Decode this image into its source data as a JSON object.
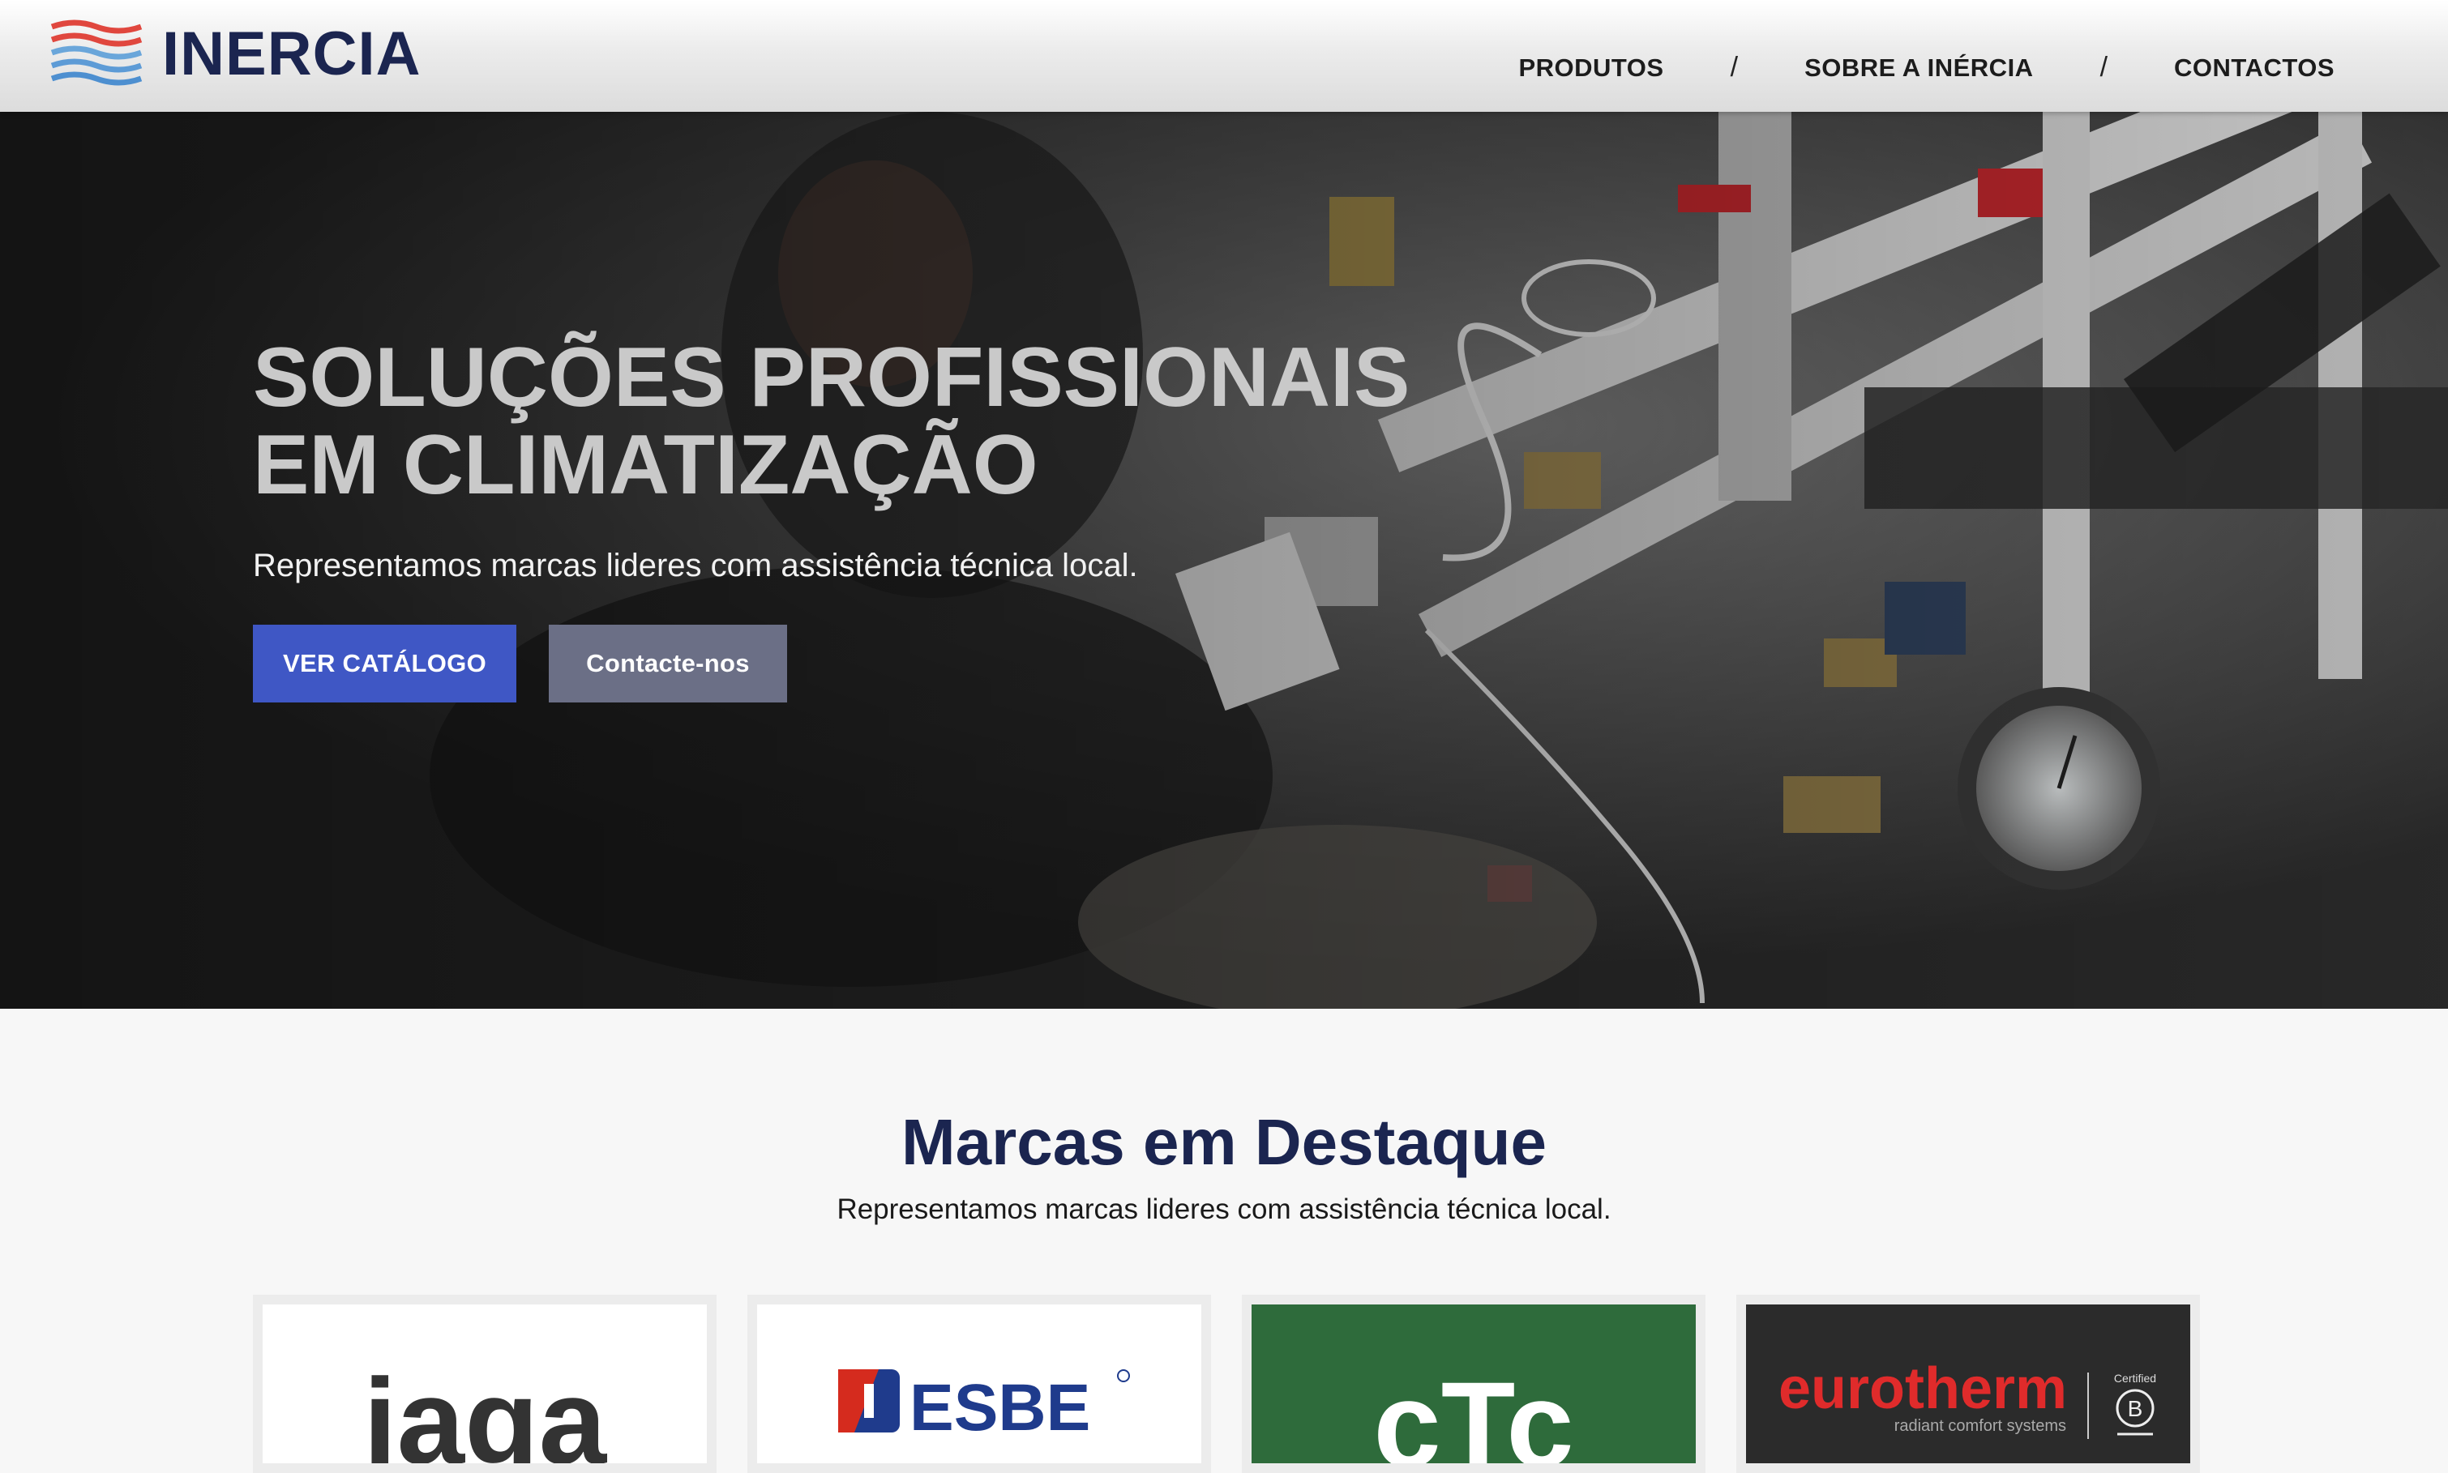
{
  "header": {
    "logo_text": "INERCIA",
    "nav": [
      {
        "label": "PRODUTOS"
      },
      {
        "label": "SOBRE A INÉRCIA"
      },
      {
        "label": "CONTACTOS"
      }
    ],
    "separator": "/"
  },
  "hero": {
    "title_line1": "SOLUÇÕES PROFISSIONAIS",
    "title_line2": "EM CLIMATIZAÇÃO",
    "subtitle": "Representamos marcas lideres com assistência técnica local.",
    "primary_button": "VER CATÁLOGO",
    "secondary_button": "Contacte-nos"
  },
  "brands": {
    "title": "Marcas em Destaque",
    "subtitle": "Representamos marcas lideres com assistência técnica local.",
    "items": [
      {
        "name": "jaga",
        "background": "#ffffff",
        "color": "#333333"
      },
      {
        "name": "ESBE",
        "background": "#ffffff",
        "color": "#1f3b8c",
        "accent": "#d52b1e"
      },
      {
        "name": "cTc",
        "background": "#2e6b3b",
        "color": "#ffffff"
      },
      {
        "name": "eurotherm",
        "tagline": "radiant comfort systems",
        "badge": "Certified",
        "background": "#2b2b2b",
        "color": "#e02b2b"
      }
    ]
  },
  "colors": {
    "brand_navy": "#1b2550",
    "primary_button": "#3f57c5",
    "secondary_button": "#6b6f86"
  }
}
